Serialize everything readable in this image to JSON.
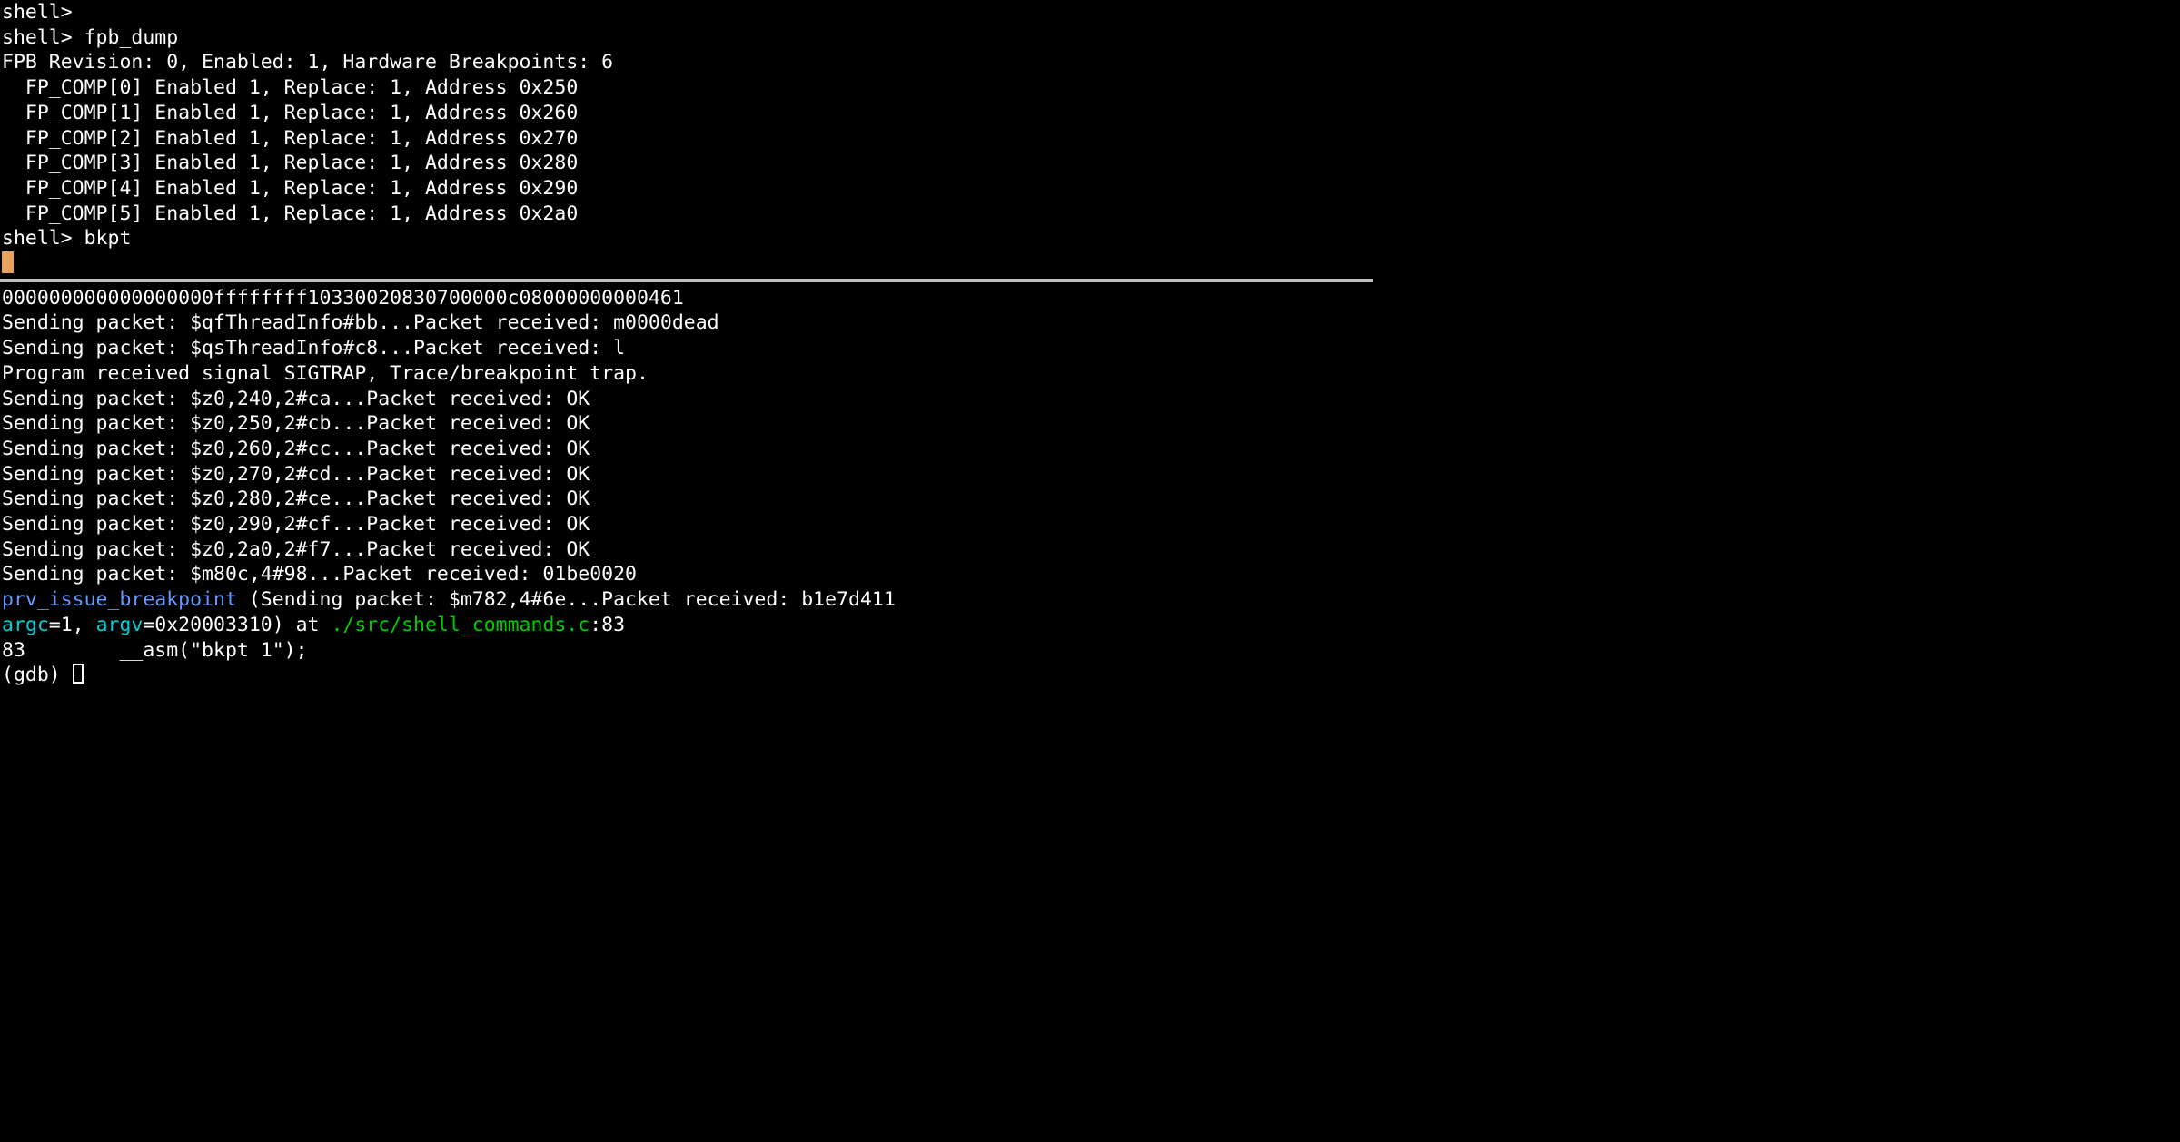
{
  "top": {
    "line0": "shell>",
    "line1": "shell> fpb_dump",
    "line2": "FPB Revision: 0, Enabled: 1, Hardware Breakpoints: 6",
    "fp": [
      "  FP_COMP[0] Enabled 1, Replace: 1, Address 0x250",
      "  FP_COMP[1] Enabled 1, Replace: 1, Address 0x260",
      "  FP_COMP[2] Enabled 1, Replace: 1, Address 0x270",
      "  FP_COMP[3] Enabled 1, Replace: 1, Address 0x280",
      "  FP_COMP[4] Enabled 1, Replace: 1, Address 0x290",
      "  FP_COMP[5] Enabled 1, Replace: 1, Address 0x2a0"
    ],
    "line9": "shell> bkpt"
  },
  "bottom": {
    "hex": "000000000000000000ffffffff10330020830700000c08000000000461",
    "l1": "Sending packet: $qfThreadInfo#bb...Packet received: m0000dead",
    "l2": "Sending packet: $qsThreadInfo#c8...Packet received: l",
    "blank": "",
    "sig": "Program received signal SIGTRAP, Trace/breakpoint trap.",
    "z0": "Sending packet: $z0,240,2#ca...Packet received: OK",
    "z1": "Sending packet: $z0,250,2#cb...Packet received: OK",
    "z2": "Sending packet: $z0,260,2#cc...Packet received: OK",
    "z3": "Sending packet: $z0,270,2#cd...Packet received: OK",
    "z4": "Sending packet: $z0,280,2#ce...Packet received: OK",
    "z5": "Sending packet: $z0,290,2#cf...Packet received: OK",
    "z6": "Sending packet: $z0,2a0,2#f7...Packet received: OK",
    "m1": "Sending packet: $m80c,4#98...Packet received: 01be0020",
    "fn": "prv_issue_breakpoint",
    "after_fn": " (Sending packet: $m782,4#6e...Packet received: b1e7d411",
    "argc_param": "argc",
    "argc_val": "=1, ",
    "argv_param": "argv",
    "argv_val": "=0x20003310) at ",
    "path": "./src/shell_commands.c",
    "path_tail": ":83",
    "src": "83        __asm(\"bkpt 1\");",
    "prompt": "(gdb) "
  }
}
